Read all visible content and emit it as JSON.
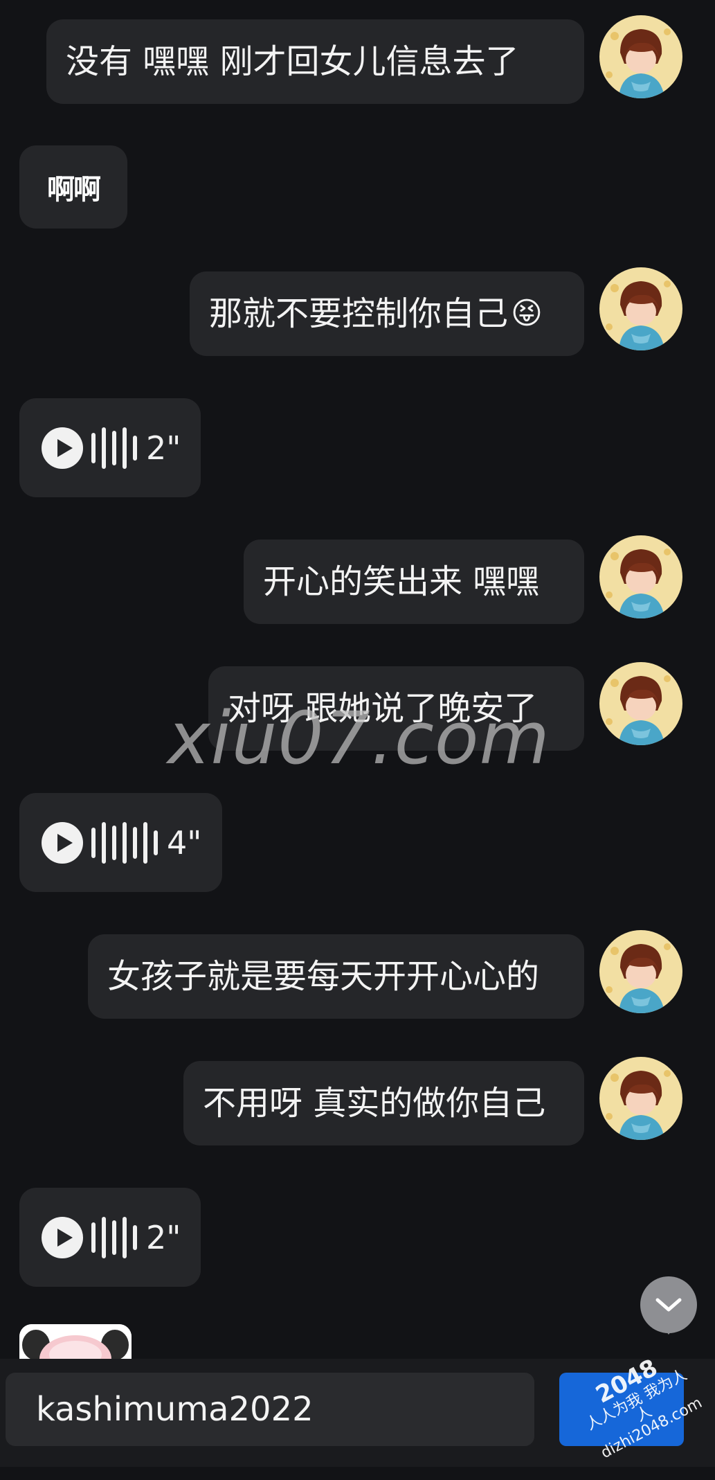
{
  "messages": [
    {
      "text": "没有 嘿嘿   刚才回女儿信息去了"
    },
    {
      "text": "啊啊"
    },
    {
      "text": "那就不要控制你自己",
      "emoji": "😝"
    },
    {
      "duration": "2\""
    },
    {
      "text": "开心的笑出来  嘿嘿"
    },
    {
      "text": "对呀  跟她说了晚安了"
    },
    {
      "duration": "4\""
    },
    {
      "text": "女孩子就是要每天开开心心的"
    },
    {
      "text": "不用呀 真实的做你自己"
    },
    {
      "duration": "2\""
    }
  ],
  "watermark": "xiu07.com",
  "composer": {
    "input_value": "kashimuma2022"
  },
  "stamp": {
    "line1": "2048",
    "line2": "人人为我 我为人人",
    "line3": "dizhi2048.com"
  },
  "icons": {
    "play": "play-icon",
    "waveform": "waveform-icon",
    "scroll_down": "chevron-down-icon"
  },
  "colors": {
    "background": "#121316",
    "bubble": "#252629",
    "send_button": "#1667d9"
  }
}
